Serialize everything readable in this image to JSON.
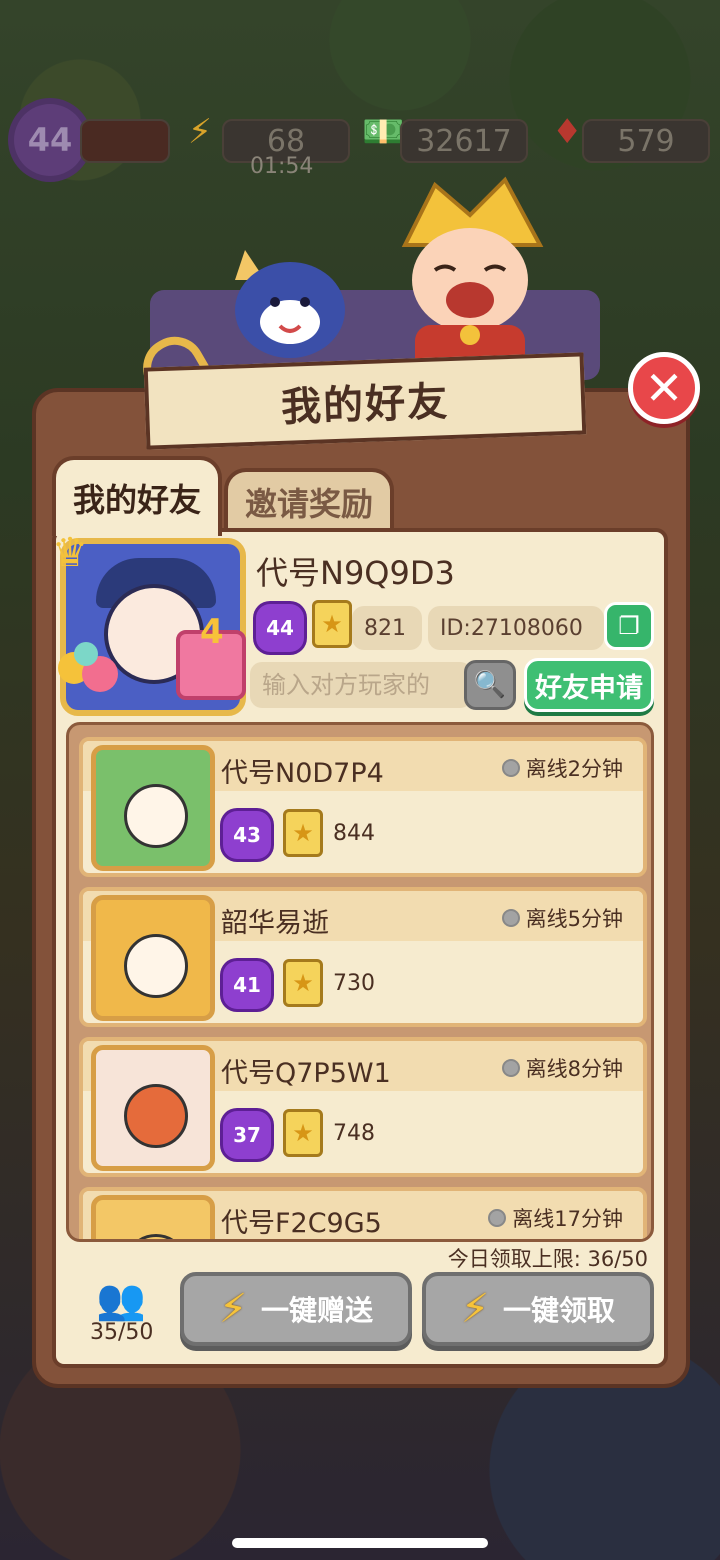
{
  "resources": {
    "level": "44",
    "energy": "68",
    "energy_timer": "01:54",
    "cash": "32617",
    "gems": "579"
  },
  "panel": {
    "title": "我的好友",
    "close_icon": "✕"
  },
  "tabs": [
    {
      "label": "我的好友",
      "active": true
    },
    {
      "label": "邀请奖励",
      "active": false
    }
  ],
  "me": {
    "name": "代号N9Q9D3",
    "level": "44",
    "score": "821",
    "id": "ID:27108060",
    "badge_num": "4"
  },
  "search": {
    "placeholder": "输入对方玩家的",
    "apply_label": "好友申请"
  },
  "friends": [
    {
      "name": "代号N0D7P4",
      "status": "离线2分钟",
      "level": "43",
      "score": "844"
    },
    {
      "name": "韶华易逝",
      "status": "离线5分钟",
      "level": "41",
      "score": "730"
    },
    {
      "name": "代号Q7P5W1",
      "status": "离线8分钟",
      "level": "37",
      "score": "748"
    },
    {
      "name": "代号F2C9G5",
      "status": "离线17分钟",
      "level": "",
      "score": ""
    }
  ],
  "footer": {
    "daily_limit": "今日领取上限: 36/50",
    "friend_count": "35/50",
    "send_all_label": "一键赠送",
    "claim_all_label": "一键领取"
  },
  "colors": {
    "panel_brown": "#83523a",
    "paper": "#f6ebcf",
    "accent_green": "#3fbf73",
    "close_red": "#e8474a",
    "level_purple": "#8e3fcf",
    "disabled_gray": "#a6a6a6"
  },
  "icons": [
    "lightning-icon",
    "cash-icon",
    "gem-icon",
    "close-icon",
    "copy-icon",
    "search-icon",
    "clipboard-star-icon",
    "friends-icon"
  ]
}
